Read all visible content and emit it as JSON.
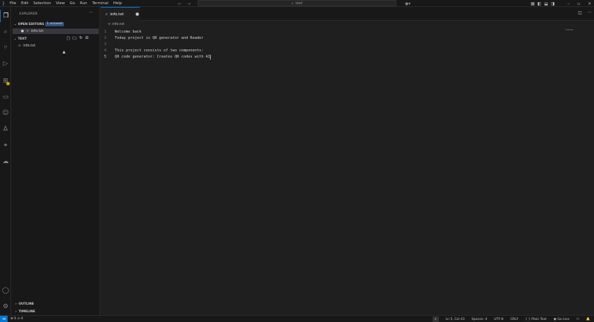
{
  "menu": [
    "File",
    "Edit",
    "Selection",
    "View",
    "Go",
    "Run",
    "Terminal",
    "Help"
  ],
  "command_center": {
    "text": "text"
  },
  "sidebar": {
    "title": "EXPLORER",
    "open_editors": {
      "label": "OPEN EDITORS",
      "badge": "1 unsaved",
      "file": "info.txt"
    },
    "folder": {
      "label": "TEXT",
      "file": "info.txt"
    },
    "outline_label": "OUTLINE",
    "timeline_label": "TIMELINE"
  },
  "editor": {
    "tab_label": "info.txt",
    "breadcrumb": "info.txt",
    "lines": [
      {
        "n": "1",
        "text": "Welcome back"
      },
      {
        "n": "2",
        "text": "Today project is QR generator and Reader"
      },
      {
        "n": "3",
        "text": ""
      },
      {
        "n": "4",
        "text": "This project consists of two components:"
      },
      {
        "n": "5",
        "text": "QR code generator: Creates QR codes with AI"
      }
    ]
  },
  "statusbar": {
    "problems": "⊗ 0 ⚠ 0",
    "position": "Ln 5, Col 43",
    "spaces": "Spaces: 4",
    "encoding": "UTF-8",
    "eol": "CRLF",
    "language": "Plain Text",
    "go_live": "Go Live"
  },
  "icons": {
    "explorer": "files-icon",
    "search": "search-icon",
    "scm": "source-control-icon",
    "run": "run-debug-icon",
    "extensions": "extensions-icon",
    "accounts": "account-icon",
    "settings": "gear-icon"
  },
  "colors": {
    "accent": "#0078d4",
    "background": "#1f1f1f",
    "sidebar": "#181818"
  }
}
